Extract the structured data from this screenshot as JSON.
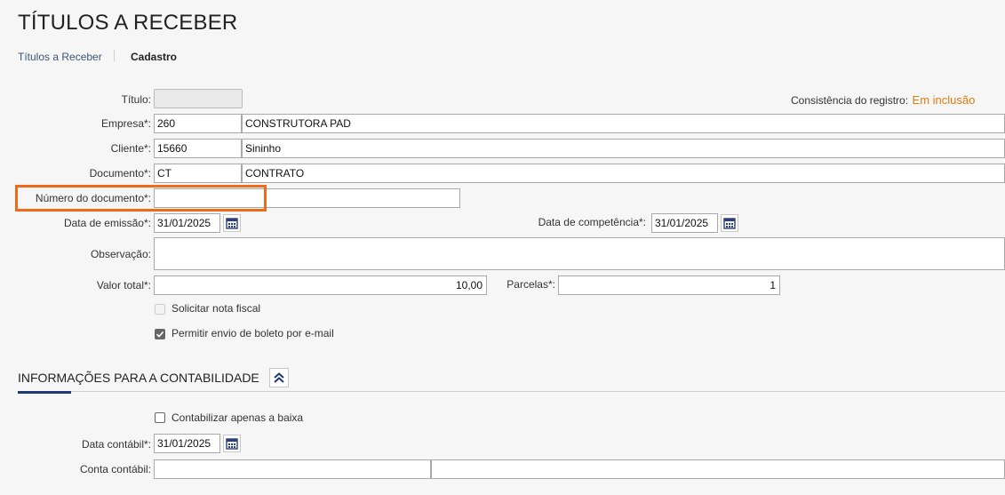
{
  "header": {
    "title": "TÍTULOS A RECEBER"
  },
  "breadcrumb": {
    "item1": "Títulos a Receber",
    "item2": "Cadastro"
  },
  "status": {
    "label": "Consistência do registro:",
    "value": "Em inclusão"
  },
  "form": {
    "titulo": {
      "label": "Título:",
      "value": ""
    },
    "empresa": {
      "label": "Empresa*:",
      "code": "260",
      "name": "CONSTRUTORA PAD"
    },
    "cliente": {
      "label": "Cliente*:",
      "code": "15660",
      "name": "Sininho"
    },
    "documento": {
      "label": "Documento*:",
      "code": "CT",
      "name": "CONTRATO"
    },
    "numero_documento": {
      "label": "Número do documento*:",
      "value": ""
    },
    "data_emissao": {
      "label": "Data de emissão*:",
      "value": "31/01/2025"
    },
    "data_competencia": {
      "label": "Data de competência*:",
      "value": "31/01/2025"
    },
    "observacao": {
      "label": "Observação:",
      "value": ""
    },
    "valor_total": {
      "label": "Valor total*:",
      "value": "10,00"
    },
    "parcelas": {
      "label": "Parcelas*:",
      "value": "1"
    },
    "solicitar_nota": {
      "label": "Solicitar nota fiscal",
      "checked": false,
      "disabled": true
    },
    "permitir_boleto": {
      "label": "Permitir envio de boleto por e-mail",
      "checked": true,
      "disabled": true
    }
  },
  "contabilidade": {
    "title": "INFORMAÇÕES PARA A CONTABILIDADE",
    "contabilizar_baixa": {
      "label": "Contabilizar apenas a baixa",
      "checked": false
    },
    "data_contabil": {
      "label": "Data contábil*:",
      "value": "31/01/2025"
    },
    "conta_contabil": {
      "label": "Conta contábil:",
      "code": "",
      "name": ""
    }
  },
  "icons": {
    "calendar": "calendar-icon",
    "collapse": "double-chevron-up-icon",
    "check": "check-icon"
  },
  "colors": {
    "accent": "#e07b12",
    "highlight": "#ef6b1a",
    "navy": "#1f3a6e"
  }
}
